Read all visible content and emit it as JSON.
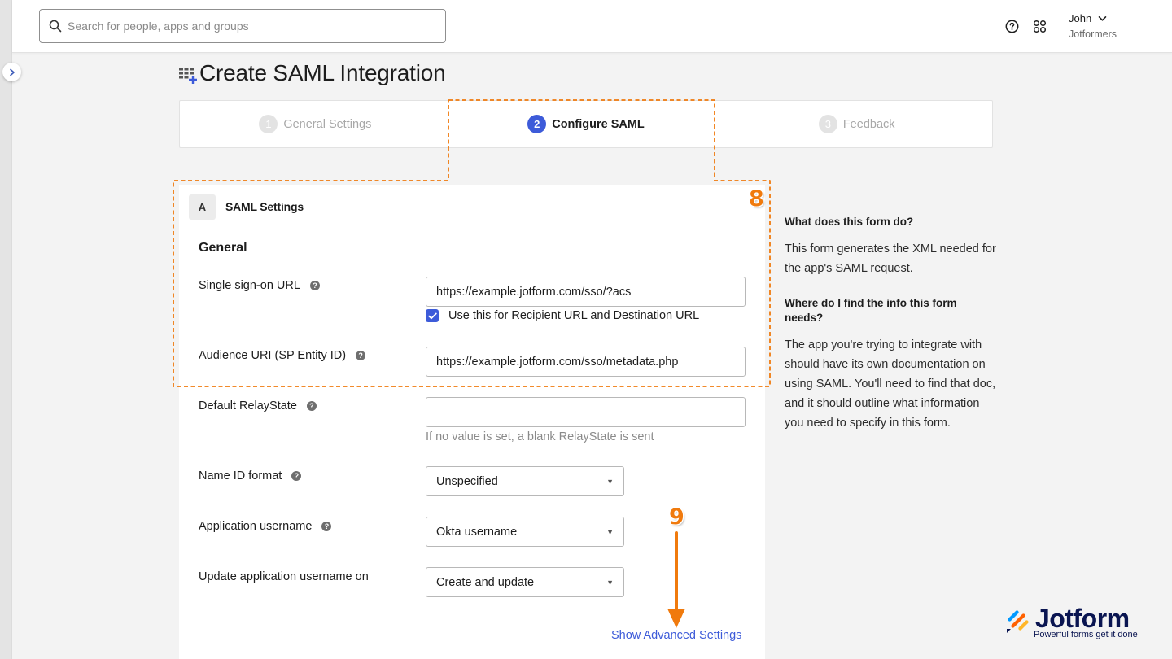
{
  "search": {
    "placeholder": "Search for people, apps and groups"
  },
  "user": {
    "name": "John",
    "org": "Jotformers"
  },
  "page": {
    "title": "Create SAML Integration"
  },
  "steps": [
    {
      "num": "1",
      "label": "General Settings",
      "state": "inactive"
    },
    {
      "num": "2",
      "label": "Configure SAML",
      "state": "active"
    },
    {
      "num": "3",
      "label": "Feedback",
      "state": "inactive"
    }
  ],
  "section": {
    "badge": "A",
    "title": "SAML Settings",
    "subtitle": "General"
  },
  "form": {
    "sso_url": {
      "label": "Single sign-on URL",
      "value": "https://example.jotform.com/sso/?acs"
    },
    "recipient_checkbox": {
      "label": "Use this for Recipient URL and Destination URL",
      "checked": true
    },
    "audience_uri": {
      "label": "Audience URI (SP Entity ID)",
      "value": "https://example.jotform.com/sso/metadata.php"
    },
    "relay_state": {
      "label": "Default RelayState",
      "value": "",
      "hint": "If no value is set, a blank RelayState is sent"
    },
    "name_id_format": {
      "label": "Name ID format",
      "value": "Unspecified"
    },
    "app_username": {
      "label": "Application username",
      "value": "Okta username"
    },
    "update_username": {
      "label": "Update application username on",
      "value": "Create and update"
    },
    "advanced_link": "Show Advanced Settings"
  },
  "help": {
    "q1": "What does this form do?",
    "a1": "This form generates the XML needed for the app's SAML request.",
    "q2": "Where do I find the info this form needs?",
    "a2": "The app you're trying to integrate with should have its own documentation on using SAML. You'll need to find that doc, and it should outline what information you need to specify in this form."
  },
  "annotations": {
    "badge8": "8",
    "badge9": "9",
    "color": "#f07a0d"
  },
  "logo": {
    "word": "Jotform",
    "tagline": "Powerful forms get it done"
  },
  "colors": {
    "accent": "#3d5bd9",
    "annotation": "#f07a0d"
  },
  "icons": [
    "chevron-right-icon",
    "search-icon",
    "help-circle-icon",
    "apps-grid-icon",
    "chevron-down-icon",
    "table-add-icon",
    "checkmark-icon",
    "caret-down-icon",
    "jotform-logo-icon"
  ]
}
